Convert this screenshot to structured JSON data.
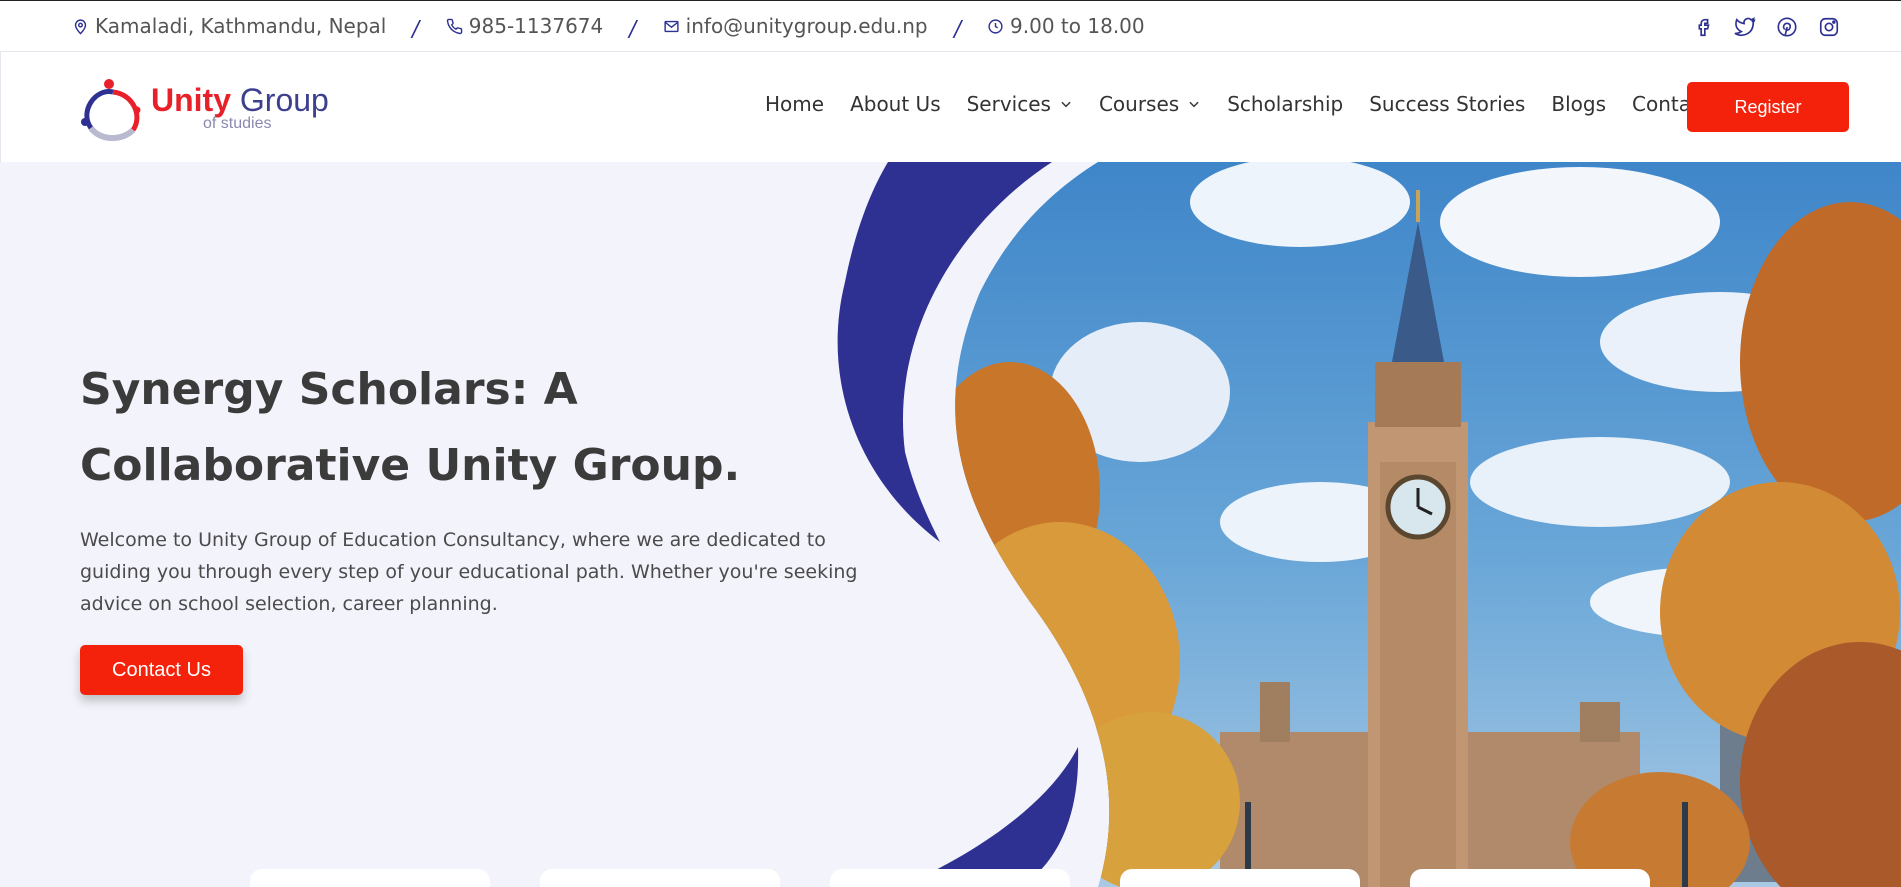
{
  "topbar": {
    "address": "Kamaladi, Kathmandu, Nepal",
    "phone": "985-1137674",
    "email": "info@unitygroup.edu.np",
    "hours": "9.00 to 18.00",
    "separator": "/",
    "icons": [
      "map-pin-icon",
      "phone-icon",
      "mail-icon",
      "clock-icon"
    ],
    "socials": [
      "facebook-icon",
      "twitter-icon",
      "pinterest-icon",
      "instagram-icon"
    ]
  },
  "logo": {
    "unity": "Unity",
    "group": " Group",
    "tagline": "of studies"
  },
  "nav": {
    "items": [
      {
        "label": "Home"
      },
      {
        "label": "About Us"
      },
      {
        "label": "Services",
        "dropdown": true
      },
      {
        "label": "Courses",
        "dropdown": true
      },
      {
        "label": "Scholarship"
      },
      {
        "label": "Success Stories"
      },
      {
        "label": "Blogs"
      },
      {
        "label": "Contact us"
      }
    ],
    "register": "Register"
  },
  "hero": {
    "title": "Synergy Scholars: A Collaborative Unity Group.",
    "description": "Welcome to Unity Group of Education Consultancy, where we are dedicated to guiding you through every step of your educational path. Whether you're seeking advice on school selection, career planning.",
    "cta": "Contact Us"
  },
  "colors": {
    "accent": "#f5220b",
    "brand_blue": "#2e3192",
    "hero_bg": "#f3f3fb"
  }
}
